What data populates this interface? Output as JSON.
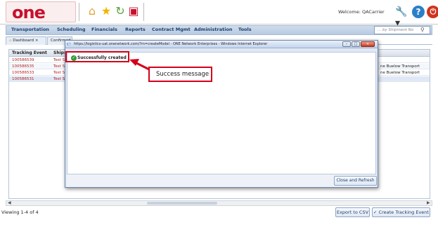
{
  "header": {
    "logo_text": "one",
    "icons": [
      "home-icon",
      "star-icon",
      "refresh-icon",
      "monitor-icon"
    ],
    "welcome": "Welcome: QACarrier",
    "tools_icon": "wrench-icon",
    "help_label": "?",
    "power_icon": "power-icon"
  },
  "nav": {
    "items": [
      "Transportation",
      "Scheduling",
      "Financials",
      "Reports",
      "Contract Mgmt",
      "Administration",
      "Tools"
    ],
    "search_placeholder": "... by Shipment No"
  },
  "tabs": [
    {
      "label": "Dashboard",
      "close": "×"
    },
    {
      "label": "Confirmed",
      "close": "×"
    }
  ],
  "grid": {
    "columns": [
      "Tracking Event",
      "Shipm"
    ],
    "rows": [
      {
        "tracking_event": "100586539",
        "shipment": "Test S",
        "carrier": ""
      },
      {
        "tracking_event": "100586535",
        "shipment": "Test S",
        "carrier": "ne Buelow Transport"
      },
      {
        "tracking_event": "100586533",
        "shipment": "Test S",
        "carrier": "ne Buelow Transport"
      },
      {
        "tracking_event": "100586531",
        "shipment": "Test S",
        "carrier": ""
      }
    ]
  },
  "footer": {
    "viewing": "Viewing 1-4 of 4",
    "export_label": "Export to CSV",
    "create_label": "Create Tracking Event"
  },
  "popup": {
    "title": "https://logistics-uat.onenetwork.com/?m=createModel - ONE Network Enterprises - Windows Internet Explorer",
    "minimize": "–",
    "maximize": "□",
    "close": "×",
    "message": "Successfully created",
    "close_refresh_label": "Close and Refresh"
  },
  "annotation": {
    "label": "Success message"
  },
  "colors": {
    "accent": "#d4001a",
    "nav_bg": "#cfdcec",
    "link": "#b22222"
  }
}
